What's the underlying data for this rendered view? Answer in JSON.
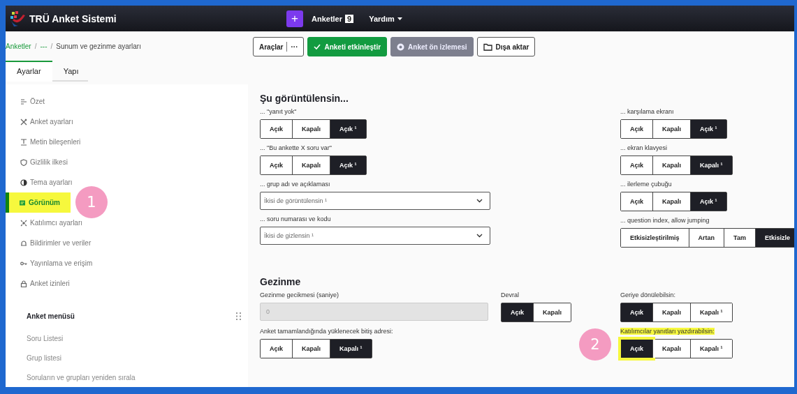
{
  "app": {
    "title": "TRÜ Anket Sistemi"
  },
  "top_nav": {
    "add_button": "+",
    "surveys_label": "Anketler",
    "surveys_count": "9",
    "help": "Yardım"
  },
  "breadcrumb": [
    "Anketler",
    "---",
    "Sunum ve gezinme ayarları"
  ],
  "breadcrumb_separator": "/",
  "toolbar": [
    {
      "kind": "tools",
      "label": "Araçlar",
      "more": "···"
    },
    {
      "kind": "activate",
      "label": "Anketi etkinleştir"
    },
    {
      "kind": "preview",
      "label": "Anket ön izlemesi"
    },
    {
      "kind": "export",
      "label": "Dışa aktar"
    }
  ],
  "tabs": [
    {
      "label": "Ayarlar",
      "selected": true
    },
    {
      "label": "Yapı",
      "selected": false
    }
  ],
  "sidebar": {
    "items": [
      {
        "label": "Özet",
        "selected": false,
        "highlighted": false
      },
      {
        "label": "Anket ayarları",
        "selected": false,
        "highlighted": false
      },
      {
        "label": "Metin bileşenleri",
        "selected": false,
        "highlighted": false
      },
      {
        "label": "Gizlilik ilkesi",
        "selected": false,
        "highlighted": false
      },
      {
        "label": "Tema ayarları",
        "selected": false,
        "highlighted": false
      },
      {
        "label": "Görünüm",
        "selected": true,
        "highlighted": true,
        "marker": "1"
      },
      {
        "label": "Katılımcı ayarları",
        "selected": false,
        "highlighted": false
      },
      {
        "label": "Bildirimler ve veriler",
        "selected": false,
        "highlighted": false
      },
      {
        "label": "Yayınlama ve erişim",
        "selected": false,
        "highlighted": false
      },
      {
        "label": "Anket izinleri",
        "selected": false,
        "highlighted": false
      }
    ],
    "menu_title": "Anket menüsü",
    "menu_items": [
      "Soru Listesi",
      "Grup listesi",
      "Soruların ve grupları yeniden sırala"
    ]
  },
  "display": {
    "title": "Şu görüntülensin...",
    "left": [
      {
        "kind": "segmented",
        "label": "... \"yanıt yok\"",
        "options": [
          {
            "label": "Açık",
            "selected": false
          },
          {
            "label": "Kapalı",
            "selected": false
          },
          {
            "label": "Açık ¹",
            "selected": true
          }
        ]
      },
      {
        "kind": "segmented",
        "label": "... \"Bu ankette X soru var\"",
        "options": [
          {
            "label": "Açık",
            "selected": false
          },
          {
            "label": "Kapalı",
            "selected": false
          },
          {
            "label": "Açık ¹",
            "selected": true
          }
        ]
      },
      {
        "kind": "select",
        "label": "... grup adı ve açıklaması",
        "value": "İkisi de görüntülensin ¹"
      },
      {
        "kind": "select",
        "label": "... soru numarası ve kodu",
        "value": "İkisi de gizlensin ¹"
      }
    ],
    "right": [
      {
        "kind": "segmented",
        "label": "... karşılama ekranı",
        "options": [
          {
            "label": "Açık",
            "selected": false
          },
          {
            "label": "Kapalı",
            "selected": false
          },
          {
            "label": "Açık ¹",
            "selected": true
          }
        ]
      },
      {
        "kind": "segmented",
        "label": "... ekran klavyesi",
        "options": [
          {
            "label": "Açık",
            "selected": false
          },
          {
            "label": "Kapalı",
            "selected": false
          },
          {
            "label": "Kapalı ¹",
            "selected": true
          }
        ]
      },
      {
        "kind": "segmented",
        "label": "... ilerleme çubuğu",
        "options": [
          {
            "label": "Açık",
            "selected": false
          },
          {
            "label": "Kapalı",
            "selected": false
          },
          {
            "label": "Açık ¹",
            "selected": true
          }
        ]
      },
      {
        "kind": "segmented",
        "label": "... question index, allow jumping",
        "options": [
          {
            "label": "Etkisizleştirilmiş",
            "selected": false
          },
          {
            "label": "Artan",
            "selected": false
          },
          {
            "label": "Tam",
            "selected": false
          },
          {
            "label": "Etkisizle",
            "selected": true
          }
        ]
      }
    ]
  },
  "navigation": {
    "title": "Gezinme",
    "settings": [
      {
        "kind": "input",
        "label": "Gezinme gecikmesi (saniye)",
        "value": "0",
        "disabled": true
      },
      {
        "kind": "segmented",
        "label": "Devral",
        "options": [
          {
            "label": "Açık",
            "selected": true
          },
          {
            "label": "Kapalı",
            "selected": false
          }
        ]
      },
      {
        "kind": "segmented",
        "label": "Geriye dönülebilsin:",
        "options": [
          {
            "label": "Açık",
            "selected": true
          },
          {
            "label": "Kapalı",
            "selected": false
          },
          {
            "label": "Kapalı ¹",
            "selected": false
          }
        ]
      },
      {
        "kind": "segmented",
        "label": "Anket tamamlandığında yüklenecek bitiş adresi:",
        "options": [
          {
            "label": "Açık",
            "selected": false
          },
          {
            "label": "Kapalı",
            "selected": false
          },
          {
            "label": "Kapalı ¹",
            "selected": true
          }
        ]
      },
      {
        "kind": "segmented",
        "label": "Katılımcılar yanıtları yazdırabilsin:",
        "highlighted": true,
        "marker": "2",
        "options": [
          {
            "label": "Açık",
            "selected": true
          },
          {
            "label": "Kapalı",
            "selected": false
          },
          {
            "label": "Kapalı ¹",
            "selected": false
          }
        ]
      }
    ]
  }
}
